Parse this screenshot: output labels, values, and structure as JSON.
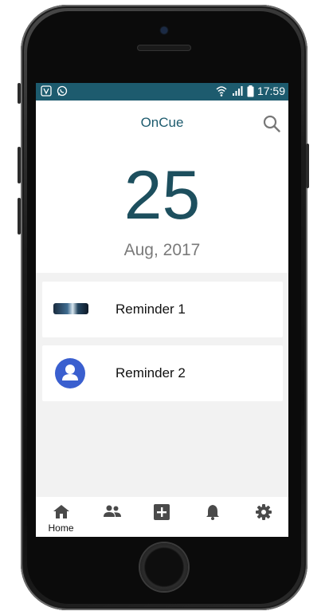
{
  "status_bar": {
    "time": "17:59"
  },
  "app_bar": {
    "title": "OnCue"
  },
  "date_display": {
    "day": "25",
    "month_year": "Aug, 2017"
  },
  "reminders": [
    {
      "label": "Reminder 1",
      "icon": "image-thumbnail"
    },
    {
      "label": "Reminder 2",
      "icon": "person-avatar-icon"
    }
  ],
  "bottom_nav": [
    {
      "label": "Home",
      "icon": "home-icon"
    },
    {
      "label": "",
      "icon": "people-icon"
    },
    {
      "label": "",
      "icon": "add-box-icon"
    },
    {
      "label": "",
      "icon": "bell-icon"
    },
    {
      "label": "",
      "icon": "gear-icon"
    }
  ],
  "colors": {
    "primary": "#1d5b6e",
    "day_number": "#1d4f5e",
    "avatar": "#3a5fcf",
    "background": "#f2f2f2"
  }
}
